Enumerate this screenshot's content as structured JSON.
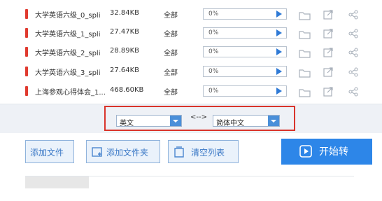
{
  "files": [
    {
      "name": "大学英语六级_0_spli",
      "size": "32.84KB",
      "pages": "全部",
      "progress_text": "0%",
      "progress": 0
    },
    {
      "name": "大学英语六级_1_spli",
      "size": "27.47KB",
      "pages": "全部",
      "progress_text": "0%",
      "progress": 0
    },
    {
      "name": "大学英语六级_2_spli",
      "size": "28.89KB",
      "pages": "全部",
      "progress_text": "0%",
      "progress": 0
    },
    {
      "name": "大学英语六级_3_spli",
      "size": "27.64KB",
      "pages": "全部",
      "progress_text": "0%",
      "progress": 0
    },
    {
      "name": "上海参观心得体会_1...",
      "size": "468.60KB",
      "pages": "全部",
      "progress_text": "0%",
      "progress": 0
    }
  ],
  "row_icons": [
    "folder-icon",
    "open-external-icon",
    "share-icon"
  ],
  "language": {
    "source": "英文",
    "swap_symbol": "<-->",
    "target": "简体中文"
  },
  "actions": {
    "add_file": "添加文件",
    "add_folder": "添加文件夹",
    "clear_list": "清空列表",
    "start": "开始转"
  },
  "colors": {
    "accent": "#2d86e8",
    "highlight_frame": "#d9342b",
    "file_mark": "#e03a2f"
  }
}
